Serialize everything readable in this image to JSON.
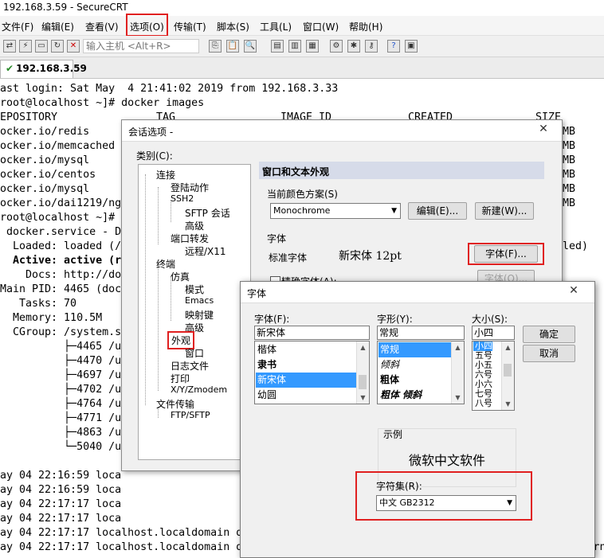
{
  "window": {
    "title": "192.168.3.59 - SecureCRT"
  },
  "menu": [
    "文件(F)",
    "编辑(E)",
    "查看(V)",
    "选项(O)",
    "传输(T)",
    "脚本(S)",
    "工具(L)",
    "窗口(W)",
    "帮助(H)"
  ],
  "toolbar": {
    "quick_connect_placeholder": "输入主机 <Alt+R>"
  },
  "tab": {
    "label": "192.168.3.59"
  },
  "terminal": {
    "lines": [
      "ast login: Sat May  4 21:41:02 2019 from 192.168.3.33",
      "root@localhost ~]# docker images",
      "EPOSITORY",
      "ocker.io/redis",
      "ocker.io/memcached",
      "ocker.io/mysql",
      "ocker.io/centos",
      "ocker.io/mysql",
      "ocker.io/dai1219/ng",
      "root@localhost ~]#",
      " docker.service - D",
      "  Loaded: loaded (/",
      "  Active: active (r",
      "    Docs: http://do",
      "Main PID: 4465 (doc",
      "   Tasks: 70",
      "  Memory: 110.5M",
      "  CGroup: /system.s",
      "          ├─4465 /u",
      "          ├─4470 /u",
      "          ├─4697 /u",
      "          ├─4702 /u",
      "          ├─4764 /u",
      "          ├─4771 /u",
      "          ├─4863 /u",
      "          └─5040 /u",
      "",
      "ay 04 22:16:59 loca",
      "ay 04 22:16:59 loca",
      "ay 04 22:17:17 loca",
      "ay 04 22:17:17 loca",
      "ay 04 22:17:17 localhost.localdomain d",
      "ay 04 22:17:17 localhost.localdomain dockerd-current[4465]: 2019-05-05T02.17.17.65691?z 0 [warn"
    ],
    "header_cols": [
      "TAG",
      "IMAGE ID",
      "CREATED",
      "SIZE"
    ],
    "right_tail": [
      "MB",
      "MB",
      "MB",
      "MB",
      "MB",
      "MB",
      "led)"
    ]
  },
  "session_dialog": {
    "title": "会话选项 -",
    "category_label": "类别(C):",
    "tree": [
      {
        "label": "连接",
        "level": 0
      },
      {
        "label": "登陆动作",
        "level": 1
      },
      {
        "label": "SSH2",
        "level": 1
      },
      {
        "label": "SFTP 会话",
        "level": 2
      },
      {
        "label": "高级",
        "level": 2
      },
      {
        "label": "端口转发",
        "level": 1
      },
      {
        "label": "远程/X11",
        "level": 2
      },
      {
        "label": "终端",
        "level": 0
      },
      {
        "label": "仿真",
        "level": 1
      },
      {
        "label": "模式",
        "level": 2
      },
      {
        "label": "Emacs",
        "level": 2
      },
      {
        "label": "映射键",
        "level": 2
      },
      {
        "label": "高级",
        "level": 2
      },
      {
        "label": "外观",
        "level": 1
      },
      {
        "label": "窗口",
        "level": 2
      },
      {
        "label": "日志文件",
        "level": 1
      },
      {
        "label": "打印",
        "level": 1
      },
      {
        "label": "X/Y/Zmodem",
        "level": 1
      },
      {
        "label": "文件传输",
        "level": 0
      },
      {
        "label": "FTP/SFTP",
        "level": 1
      }
    ],
    "panel_title": "窗口和文本外观",
    "color_scheme_label": "当前颜色方案(S)",
    "color_scheme_value": "Monochrome",
    "edit_button": "编辑(E)...",
    "new_button": "新建(W)...",
    "font_section": "字体",
    "normal_font_label": "标准字体",
    "normal_font_value": "新宋体 12pt",
    "font_button": "字体(F)...",
    "precise_font_label": "精确字体(A):",
    "font_button2": "字体(O)..."
  },
  "font_dialog": {
    "title": "字体",
    "font_label": "字体(F):",
    "font_value": "新宋体",
    "fonts": [
      "楷体",
      "隶书",
      "新宋体",
      "幼圆"
    ],
    "selected_font": "新宋体",
    "style_label": "字形(Y):",
    "style_value": "常规",
    "styles": [
      "常规",
      "倾斜",
      "粗体",
      "粗体 倾斜"
    ],
    "size_label": "大小(S):",
    "size_value": "小四",
    "sizes": [
      "小四",
      "五号",
      "小五",
      "六号",
      "小六",
      "七号",
      "八号"
    ],
    "ok_button": "确定",
    "cancel_button": "取消",
    "sample_label": "示例",
    "sample_text": "微软中文软件",
    "charset_label": "字符集(R):",
    "charset_value": "中文 GB2312"
  }
}
